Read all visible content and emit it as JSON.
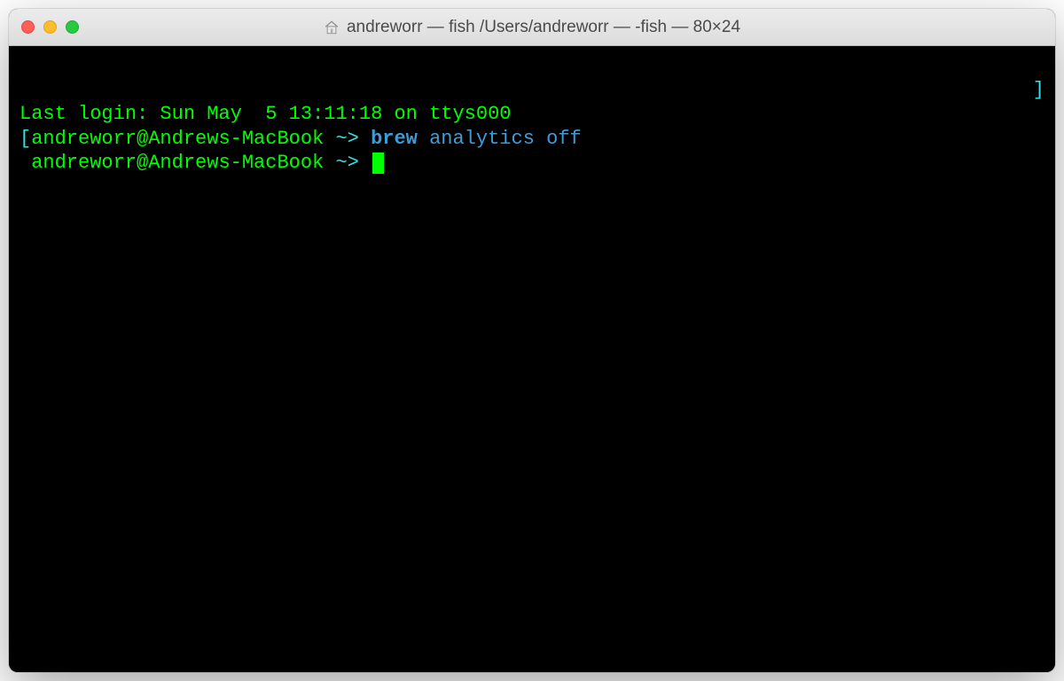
{
  "window": {
    "title": "andreworr — fish  /Users/andreworr — -fish — 80×24"
  },
  "terminal": {
    "lines": [
      {
        "segments": [
          {
            "text": "Last login: Sun May  5 13:11:18 on ttys000",
            "cls": "txt-green"
          }
        ]
      },
      {
        "segments": [
          {
            "text": "[",
            "cls": "txt-cyan"
          },
          {
            "text": "andreworr@Andrews-MacBook",
            "cls": "txt-green"
          },
          {
            "text": " ~> ",
            "cls": "txt-cyan"
          },
          {
            "text": "brew",
            "cls": "txt-blue txt-bold"
          },
          {
            "text": " ",
            "cls": ""
          },
          {
            "text": "analytics off",
            "cls": "txt-blue"
          }
        ],
        "right_bracket": "]"
      },
      {
        "segments": [
          {
            "text": " ",
            "cls": ""
          },
          {
            "text": "andreworr@Andrews-MacBook",
            "cls": "txt-green"
          },
          {
            "text": " ~> ",
            "cls": "txt-cyan"
          }
        ],
        "cursor": true
      }
    ]
  }
}
